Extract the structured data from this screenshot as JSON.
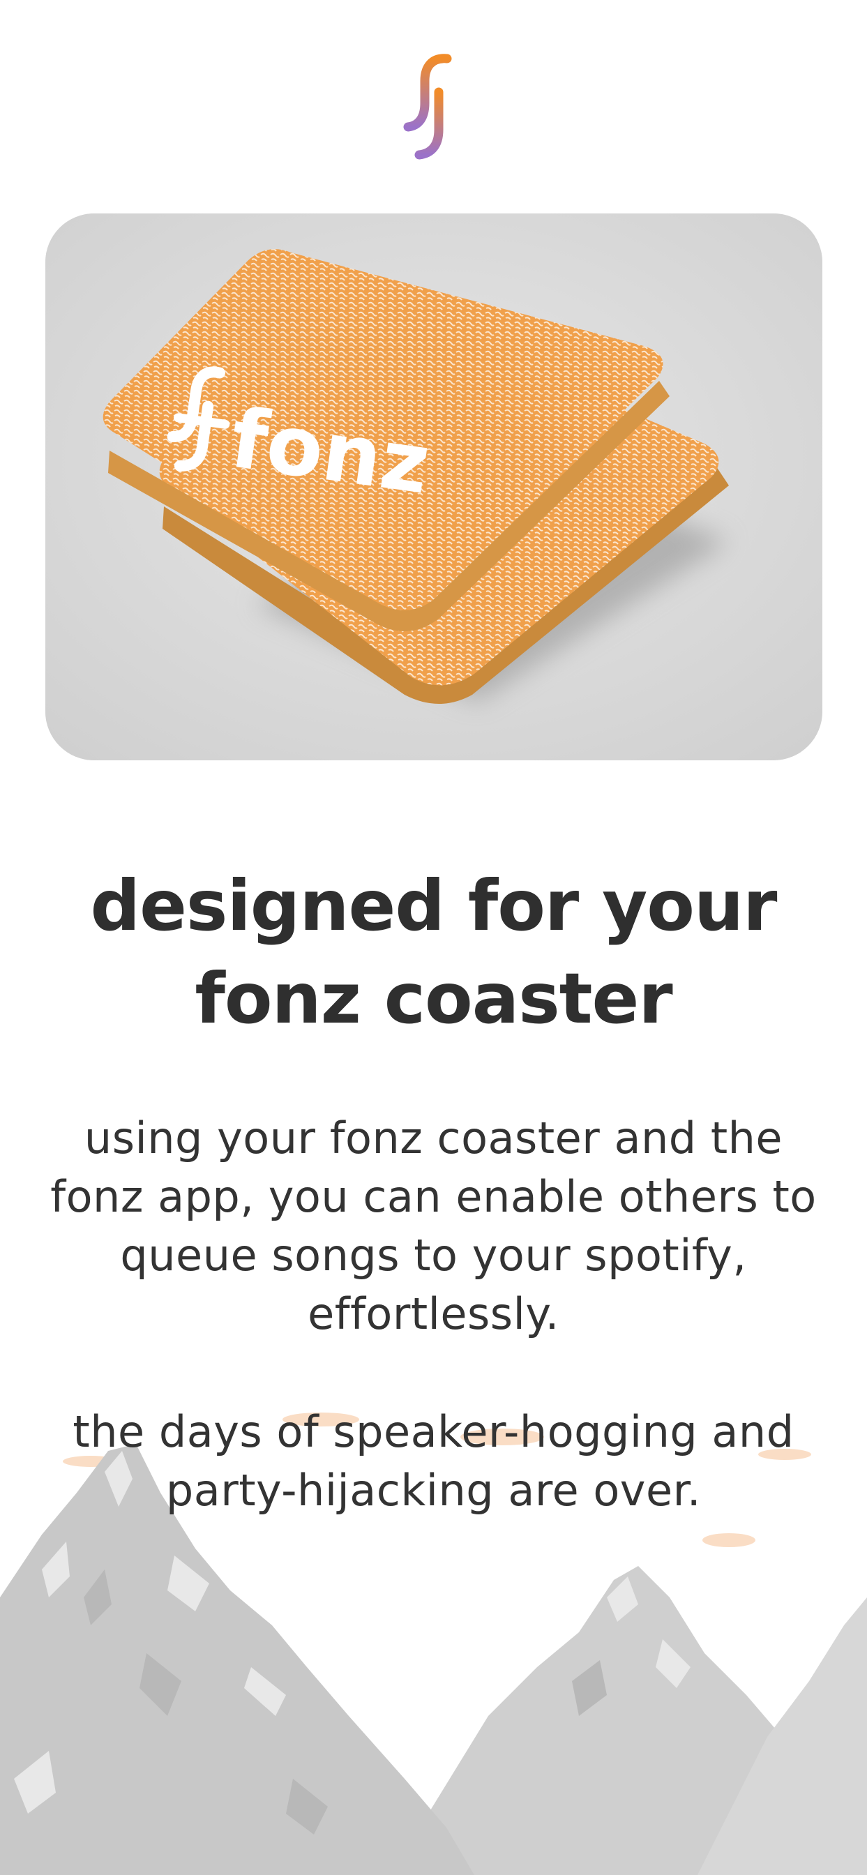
{
  "brand": {
    "logo_icon": "fonz-f-logo-icon",
    "gradient": [
      "#f28c28",
      "#9b72c9"
    ]
  },
  "hero": {
    "image_subject": "stack of orange fonz coasters",
    "coaster_wordmark": "fonz",
    "colors": {
      "background": "#d9d9d9",
      "coaster": "#f0a04b",
      "edge": "#c98a3c"
    }
  },
  "headline": "designed for your fonz coaster",
  "body": {
    "paragraph_1": "using your fonz coaster and the fonz app, you can enable others to queue songs to your spotify, effortlessly.",
    "paragraph_2": "the days of speaker-hogging and party-hijacking are over."
  },
  "decor": {
    "mountains_icon": "mountain-range-icon",
    "mountain_color": "#c4c4c4",
    "cloud_color": "#f9d9bf"
  }
}
